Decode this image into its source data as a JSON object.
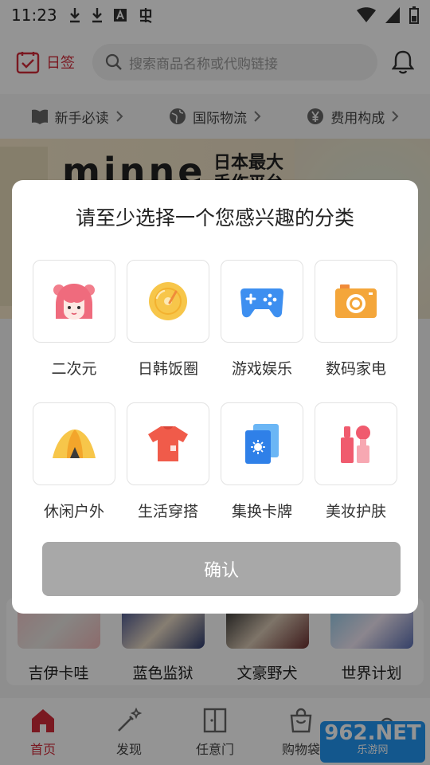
{
  "status_bar": {
    "time": "11:23"
  },
  "header": {
    "checkin_label": "日签",
    "search_placeholder": "搜索商品名称或代购链接"
  },
  "info_strip": [
    {
      "label": "新手必读",
      "icon": "book-icon"
    },
    {
      "label": "国际物流",
      "icon": "globe-icon"
    },
    {
      "label": "费用构成",
      "icon": "yen-icon"
    }
  ],
  "banner": {
    "brand": "minne",
    "tagline_line1": "日本最大",
    "tagline_line2": "手作平台"
  },
  "cards": [
    {
      "label": "吉伊卡哇"
    },
    {
      "label": "蓝色监狱"
    },
    {
      "label": "文豪野犬"
    },
    {
      "label": "世界计划"
    }
  ],
  "bottom_nav": [
    {
      "label": "首页",
      "icon": "home-icon",
      "active": true
    },
    {
      "label": "发现",
      "icon": "magic-wand-icon"
    },
    {
      "label": "任意门",
      "icon": "door-icon"
    },
    {
      "label": "购物袋",
      "icon": "bag-icon"
    },
    {
      "label": "",
      "icon": "user-icon"
    }
  ],
  "watermark": {
    "line1": "962.NET",
    "line2": "乐游网"
  },
  "modal": {
    "title": "请至少选择一个您感兴趣的分类",
    "confirm_label": "确认",
    "categories": [
      {
        "label": "二次元",
        "icon": "anime-girl-icon"
      },
      {
        "label": "日韩饭圈",
        "icon": "vinyl-record-icon"
      },
      {
        "label": "游戏娱乐",
        "icon": "gamepad-icon"
      },
      {
        "label": "数码家电",
        "icon": "camera-icon"
      },
      {
        "label": "休闲户外",
        "icon": "tent-icon"
      },
      {
        "label": "生活穿搭",
        "icon": "tshirt-icon"
      },
      {
        "label": "集换卡牌",
        "icon": "cards-icon"
      },
      {
        "label": "美妆护肤",
        "icon": "cosmetics-icon"
      }
    ]
  },
  "colors": {
    "accent": "#d32b3a",
    "confirm_disabled": "#a8a8a8"
  }
}
